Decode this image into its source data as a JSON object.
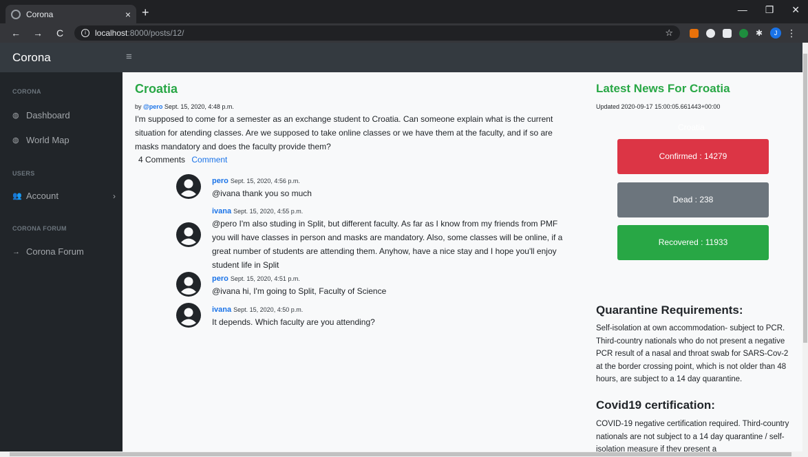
{
  "browser": {
    "tab_title": "Corona",
    "tab_close": "×",
    "new_tab": "+",
    "url_host": "localhost",
    "url_path": ":8000/posts/12/",
    "profile_initial": "J"
  },
  "header": {
    "brand": "Corona",
    "menu_icon": "≡"
  },
  "sidebar": {
    "sections": [
      {
        "heading": "CORONA",
        "items": [
          {
            "label": "Dashboard",
            "icon": "palette-icon"
          },
          {
            "label": "World Map",
            "icon": "palette-icon"
          }
        ]
      },
      {
        "heading": "USERS",
        "items": [
          {
            "label": "Account",
            "icon": "users-icon"
          }
        ]
      },
      {
        "heading": "CORONA FORUM",
        "items": [
          {
            "label": "Corona Forum",
            "icon": "arrow-right-icon"
          }
        ]
      }
    ]
  },
  "post": {
    "title": "Croatia",
    "by": "by",
    "author": "@pero",
    "date": "Sept. 15, 2020, 4:48 p.m.",
    "body": "I'm supposed to come for a semester as an exchange student to Croatia. Can someone explain what is the current situation for atending classes. Are we supposed to take online classes or we have them at the faculty, and if so are masks mandatory and does the faculty provide them?",
    "comments_count": "4 Comments",
    "comment_link": "Comment"
  },
  "comments": [
    {
      "name": "pero",
      "date": "Sept. 15, 2020, 4:56 p.m.",
      "text": "@ivana thank you so much"
    },
    {
      "name": "ivana",
      "date": "Sept. 15, 2020, 4:55 p.m.",
      "text": "@pero I'm also studing in Split, but different faculty. As far as I know from my friends from PMF you will have classes in person and masks are mandatory. Also, some classes will be online, if a great number of students are attending them. Anyhow, have a nice stay and I hope you'll enjoy student life in Split"
    },
    {
      "name": "pero",
      "date": "Sept. 15, 2020, 4:51 p.m.",
      "text": "@ivana hi, I'm going to Split, Faculty of Science"
    },
    {
      "name": "ivana",
      "date": "Sept. 15, 2020, 4:50 p.m.",
      "text": "It depends. Which faculty are you attending?"
    }
  ],
  "news": {
    "title": "Latest News For Croatia",
    "updated": "Updated 2020-09-17 15:00:05.661443+00:00",
    "country": "Croatia",
    "confirmed": "Confirmed : 14279",
    "dead": "Dead : 238",
    "recovered": "Recovered : 11933",
    "colors": {
      "confirmed": "#dc3545",
      "dead": "#6c757d",
      "recovered": "#28a745"
    }
  },
  "quarantine": {
    "title": "Quarantine Requirements:",
    "text": "Self-isolation at own accommodation- subject to PCR. Third-country nationals who do not present a negative PCR result of a nasal and throat swab for SARS-Cov-2 at the border crossing point, which is not older than 48 hours, are subject to a 14 day quarantine."
  },
  "certification": {
    "title": "Covid19 certification:",
    "text": "COVID-19 negative certification required. Third-country nationals are not subject to a 14 day quarantine / self-isolation measure if they present a"
  }
}
